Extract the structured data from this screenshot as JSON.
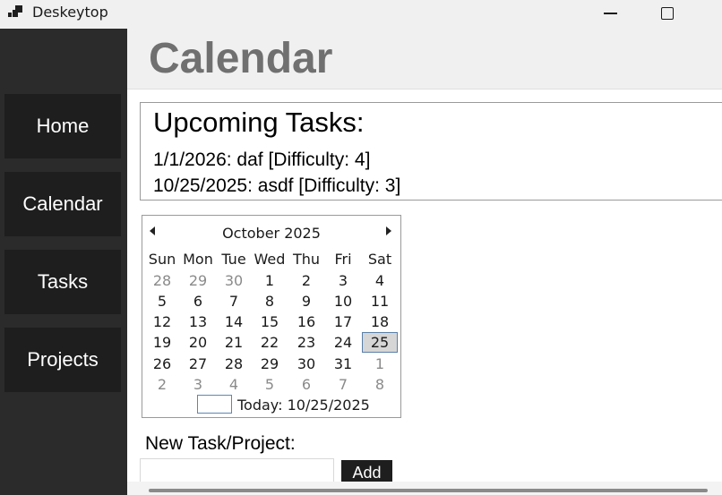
{
  "window": {
    "title": "Deskeytop",
    "icons": {
      "app": "app-logo-icon",
      "minimize": "minimize-icon",
      "maximize": "maximize-icon"
    }
  },
  "sidebar": {
    "items": [
      {
        "label": "Home"
      },
      {
        "label": "Calendar"
      },
      {
        "label": "Tasks"
      },
      {
        "label": "Projects"
      }
    ]
  },
  "header": {
    "title": "Calendar"
  },
  "upcoming": {
    "title": "Upcoming Tasks:",
    "tasks": [
      "1/1/2026: daf [Difficulty: 4]",
      "10/25/2025: asdf [Difficulty: 3]"
    ]
  },
  "calendar": {
    "month_label": "October 2025",
    "weekdays": [
      "Sun",
      "Mon",
      "Tue",
      "Wed",
      "Thu",
      "Fri",
      "Sat"
    ],
    "weeks": [
      [
        "28",
        "29",
        "30",
        "1",
        "2",
        "3",
        "4"
      ],
      [
        "5",
        "6",
        "7",
        "8",
        "9",
        "10",
        "11"
      ],
      [
        "12",
        "13",
        "14",
        "15",
        "16",
        "17",
        "18"
      ],
      [
        "19",
        "20",
        "21",
        "22",
        "23",
        "24",
        "25"
      ],
      [
        "26",
        "27",
        "28",
        "29",
        "30",
        "31",
        "1"
      ],
      [
        "2",
        "3",
        "4",
        "5",
        "6",
        "7",
        "8"
      ]
    ],
    "selected_day": "25",
    "today_label": "Today: 10/25/2025"
  },
  "new_task": {
    "label": "New Task/Project:",
    "input_value": "",
    "add_label": "Add"
  },
  "colors": {
    "sidebar_bg": "#2b2b2b",
    "nav_button_bg": "#1e1e1e",
    "header_bg": "#f0f0f0",
    "title_gray": "#707070",
    "selected_day_bg": "#d6d6d6"
  }
}
